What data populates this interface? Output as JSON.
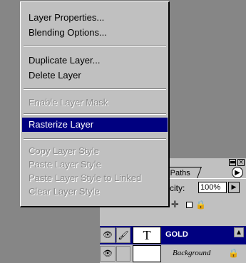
{
  "menu": {
    "items": [
      {
        "label": "Layer Properties...",
        "enabled": true
      },
      {
        "label": "Blending Options...",
        "enabled": true
      },
      {
        "label": "Duplicate Layer...",
        "enabled": true
      },
      {
        "label": "Delete Layer",
        "enabled": true
      },
      {
        "label": "Enable Layer Mask",
        "enabled": false
      },
      {
        "label": "Rasterize Layer",
        "enabled": true,
        "selected": true
      },
      {
        "label": "Copy Layer Style",
        "enabled": false
      },
      {
        "label": "Paste Layer Style",
        "enabled": false
      },
      {
        "label": "Paste Layer Style to Linked",
        "enabled": false
      },
      {
        "label": "Clear Layer Style",
        "enabled": false
      }
    ]
  },
  "palette": {
    "minimize_glyph": "▬",
    "close_glyph": "×",
    "tab_label": "Paths",
    "menu_arrow_glyph": "▶",
    "opacity_label": "city:",
    "opacity_value": "100%",
    "opacity_arrow_glyph": "▶",
    "move_glyph": "✛",
    "lock_glyph": "🔒",
    "layers": [
      {
        "name": "GOLD",
        "thumb": "T",
        "visible_glyph": "👁",
        "brush_glyph": "🖌",
        "selected": true
      },
      {
        "name": "Background",
        "thumb": "",
        "visible_glyph": "👁",
        "locked_glyph": "🔒",
        "selected": false
      }
    ],
    "scroll_up_glyph": "▲"
  },
  "colors": {
    "selection": "#000080",
    "menu_bg": "#c0c0c0",
    "desktop": "#868686"
  }
}
